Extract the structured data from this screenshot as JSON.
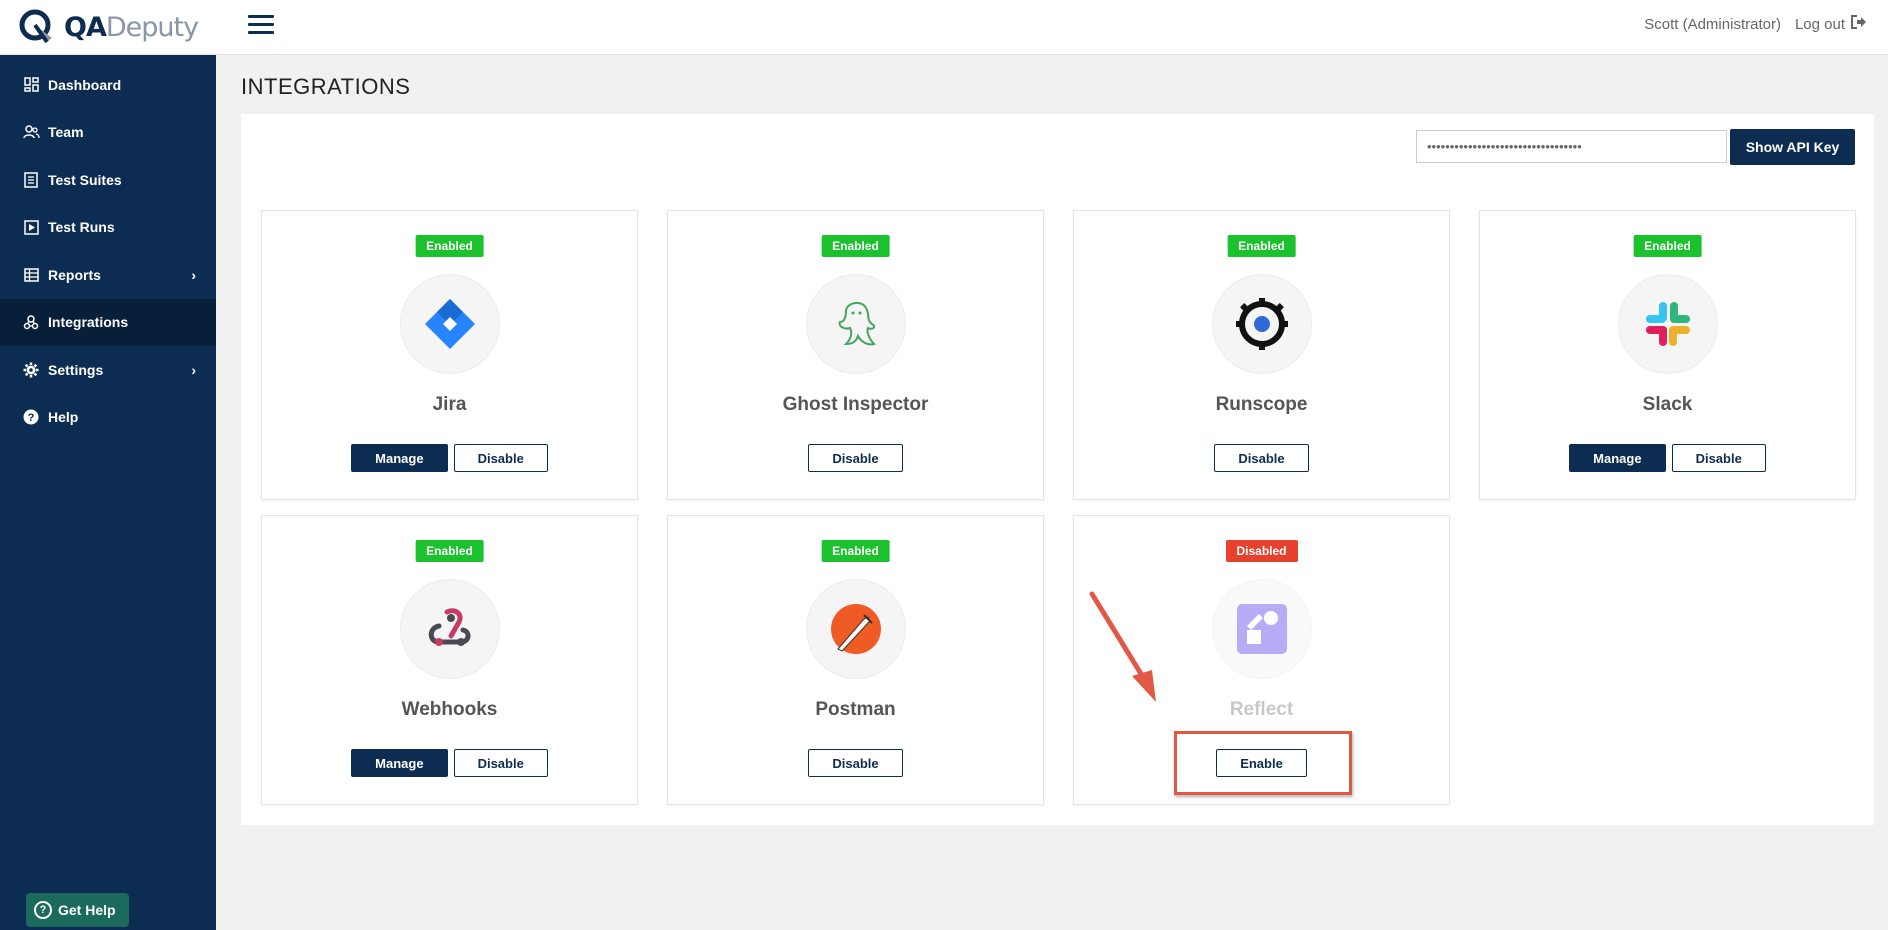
{
  "app": {
    "logo_qa": "QA",
    "logo_deputy": "Deputy"
  },
  "sidebar": {
    "items": [
      {
        "label": "Dashboard",
        "icon": "dashboard-icon"
      },
      {
        "label": "Team",
        "icon": "team-icon"
      },
      {
        "label": "Test Suites",
        "icon": "test-suites-icon"
      },
      {
        "label": "Test Runs",
        "icon": "test-runs-icon"
      },
      {
        "label": "Reports",
        "icon": "reports-icon",
        "has_submenu": true
      },
      {
        "label": "Integrations",
        "icon": "integrations-icon",
        "active": true
      },
      {
        "label": "Settings",
        "icon": "gear-icon",
        "has_submenu": true
      },
      {
        "label": "Help",
        "icon": "help-icon"
      }
    ],
    "get_help": "Get Help"
  },
  "topbar": {
    "user_name": "Scott",
    "user_role": "(Administrator)",
    "logout": "Log out"
  },
  "page": {
    "title": "INTEGRATIONS",
    "api_key_masked": "••••••••••••••••••••••••••••••••••",
    "show_api_key": "Show API Key"
  },
  "integrations": [
    {
      "name": "Jira",
      "status": "Enabled",
      "buttons": [
        "Manage",
        "Disable"
      ],
      "icon": "jira-icon"
    },
    {
      "name": "Ghost Inspector",
      "status": "Enabled",
      "buttons": [
        "Disable"
      ],
      "icon": "ghost-icon"
    },
    {
      "name": "Runscope",
      "status": "Enabled",
      "buttons": [
        "Disable"
      ],
      "icon": "runscope-icon"
    },
    {
      "name": "Slack",
      "status": "Enabled",
      "buttons": [
        "Manage",
        "Disable"
      ],
      "icon": "slack-icon"
    },
    {
      "name": "Webhooks",
      "status": "Enabled",
      "buttons": [
        "Manage",
        "Disable"
      ],
      "icon": "webhooks-icon"
    },
    {
      "name": "Postman",
      "status": "Enabled",
      "buttons": [
        "Disable"
      ],
      "icon": "postman-icon"
    },
    {
      "name": "Reflect",
      "status": "Disabled",
      "buttons": [
        "Enable"
      ],
      "icon": "reflect-icon"
    }
  ],
  "colors": {
    "sidebar_bg": "#0c2d51",
    "enabled": "#1cc12e",
    "disabled": "#e8402e",
    "annotation": "#e15845"
  }
}
